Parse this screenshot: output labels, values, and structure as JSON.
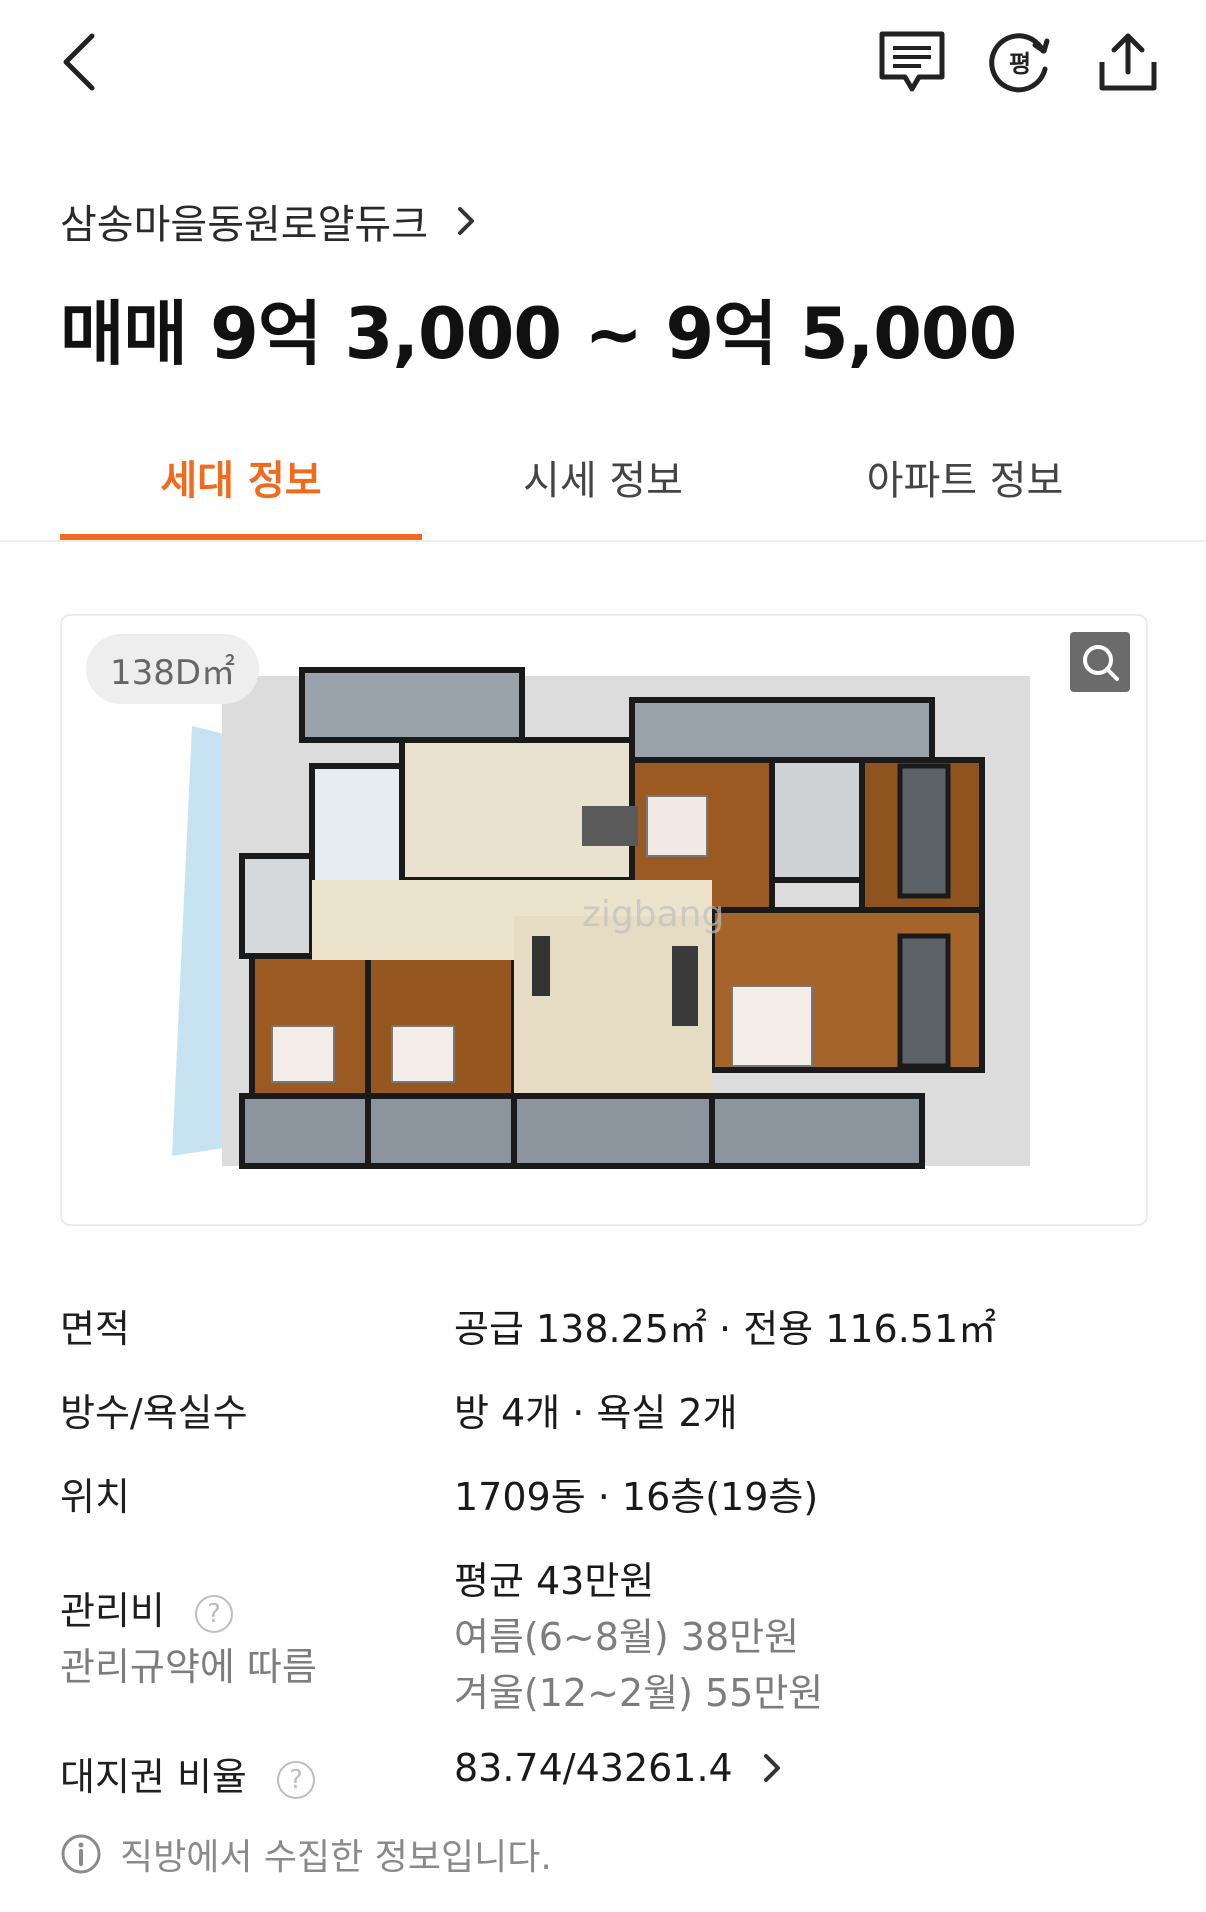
{
  "header": {
    "back_icon": "chevron-left-icon",
    "chat_icon": "chat-icon",
    "pyeong_icon_label": "평",
    "share_icon": "share-icon"
  },
  "complex": {
    "name": "삼송마을동원로얄듀크"
  },
  "price": {
    "text": "매매 9억 3,000 ~ 9억 5,000"
  },
  "tabs": [
    {
      "label": "세대 정보",
      "active": true
    },
    {
      "label": "시세 정보",
      "active": false
    },
    {
      "label": "아파트 정보",
      "active": false
    }
  ],
  "floorplan": {
    "badge": "138D㎡",
    "watermark": "zigbang"
  },
  "details": {
    "area_label": "면적",
    "area_value": "공급 138.25㎡ · 전용 116.51㎡",
    "rooms_label": "방수/욕실수",
    "rooms_value": "방 4개 · 욕실 2개",
    "location_label": "위치",
    "location_value": "1709동 · 16층(19층)",
    "fee_label": "관리비",
    "fee_sublabel": "관리규약에 따름",
    "fee_avg": "평균 43만원",
    "fee_summer": "여름(6~8월) 38만원",
    "fee_winter": "겨울(12~2월) 55만원",
    "land_label": "대지권 비율",
    "land_value": "83.74/43261.4"
  },
  "footer": {
    "notice": "직방에서 수집한 정보입니다."
  },
  "colors": {
    "accent": "#f26b1d"
  }
}
